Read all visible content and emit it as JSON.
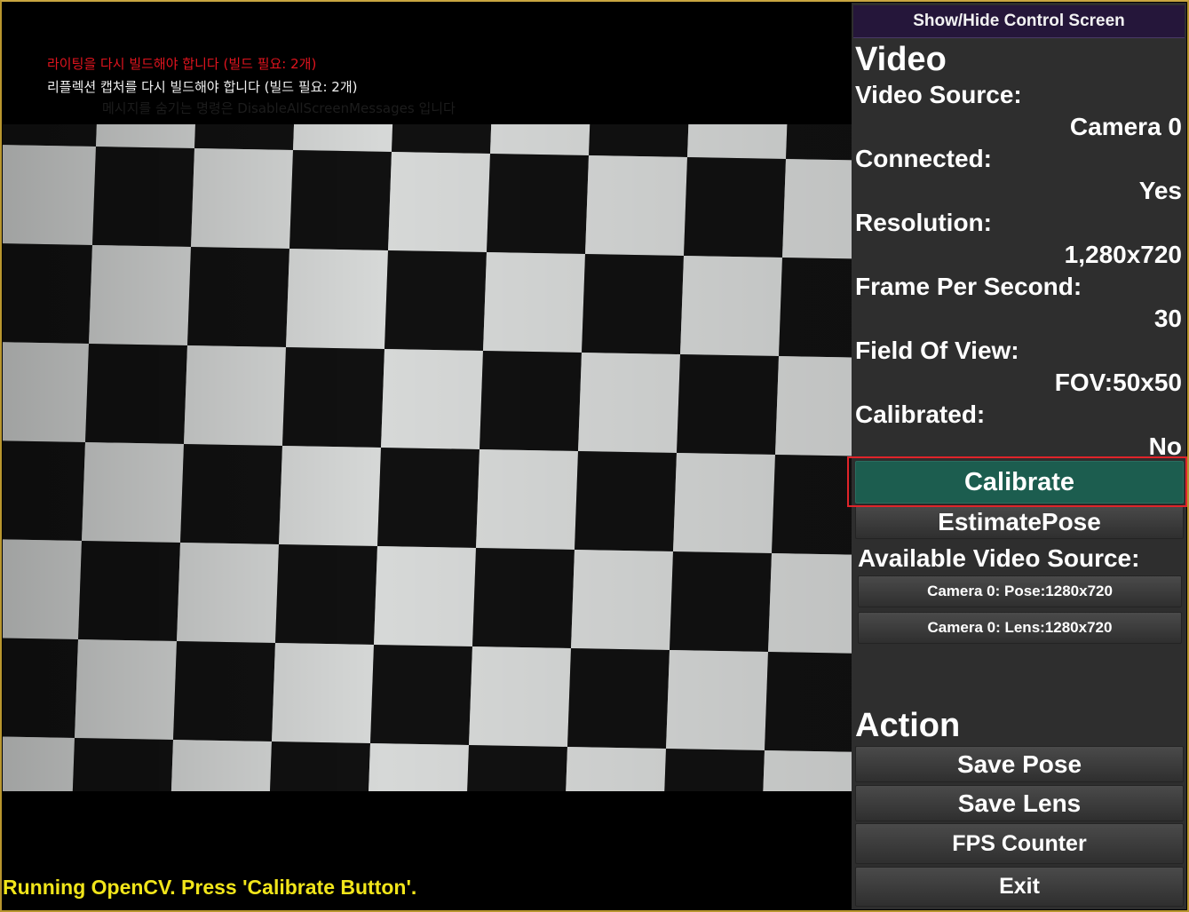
{
  "warnings": {
    "lighting": "라이팅을 다시 빌드해야 합니다 (빌드 필요: 2개)",
    "reflection": "리플렉션 캡처를 다시 빌드해야 합니다 (빌드 필요: 2개)",
    "hint": "메시지를 숨기는 명령은 DisableAllScreenMessages 입니다"
  },
  "status_text": "Running OpenCV. Press 'Calibrate Button'.",
  "panel": {
    "toggle_label": "Show/Hide Control Screen",
    "video_title": "Video",
    "rows": [
      {
        "label": "Video Source:",
        "value": "Camera 0"
      },
      {
        "label": "Connected:",
        "value": "Yes"
      },
      {
        "label": "Resolution:",
        "value": "1,280x720"
      },
      {
        "label": "Frame Per Second:",
        "value": "30"
      },
      {
        "label": "Field Of View:",
        "value": "FOV:50x50"
      },
      {
        "label": "Calibrated:",
        "value": "No"
      }
    ],
    "calibrate_label": "Calibrate",
    "estimate_label": "EstimatePose",
    "available_title": "Available Video Source:",
    "sources": [
      "Camera 0: Pose:1280x720",
      "Camera 0: Lens:1280x720"
    ],
    "action_title": "Action",
    "actions": [
      "Save Pose",
      "Save Lens",
      "FPS Counter",
      "Exit"
    ]
  },
  "colors": {
    "highlight": "#e0242a",
    "calibrate_button": "#1c5d4f",
    "status_text": "#f1e51a",
    "warning_red": "#e0141e"
  }
}
